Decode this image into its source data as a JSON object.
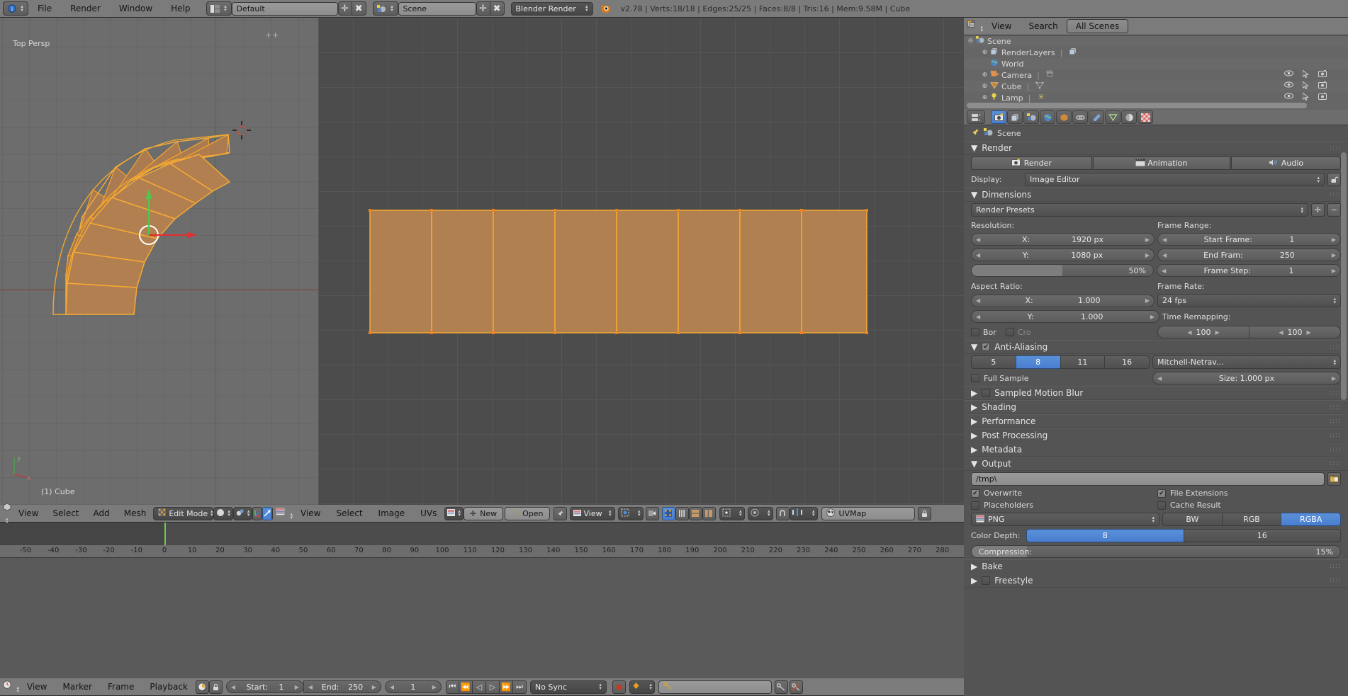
{
  "topbar": {
    "editor_icon": "editor-type-icon",
    "menus": [
      "File",
      "Render",
      "Window",
      "Help"
    ],
    "screen_layout_icon": "screen-layout-icon",
    "screen_layout": "Default",
    "scene_icon": "scene-icon",
    "scene": "Scene",
    "add_icon": "plus-icon",
    "remove_icon": "x-icon",
    "engine": "Blender Render",
    "blender_logo": "blender-logo-icon",
    "status": "v2.78 | Verts:18/18 | Edges:25/25 | Faces:8/8 | Tris:16 | Mem:9.58M | Cube"
  },
  "viewport": {
    "view_label": "Top Persp",
    "object_label": "(1) Cube",
    "axis_x": "x",
    "axis_y": "y",
    "header": {
      "editor_icon": "3d-view-icon",
      "menus": [
        "View",
        "Select",
        "Add",
        "Mesh"
      ],
      "mode_icon": "edit-mode-icon",
      "mode": "Edit Mode",
      "shading_icon": "solid-shading-icon",
      "pivot_icon": "pivot-point-icon",
      "manipulator_icons": [
        "translate-manipulator-icon",
        "rotate-manipulator-icon",
        "scale-manipulator-icon"
      ],
      "orientation_icon": "transform-orientation-icon"
    }
  },
  "uv_editor": {
    "header": {
      "editor_icon": "uv-image-editor-icon",
      "menus": [
        "View",
        "Select",
        "Image",
        "UVs"
      ],
      "image_icon": "image-datablock-icon",
      "new_label": "New",
      "new_icon": "plus-icon",
      "open_label": "Open",
      "open_icon": "folder-icon",
      "pin_icon": "pin-icon",
      "view_mode_icon": "image-icon",
      "view_mode": "View",
      "uv_select_mode_icon": "uv-vertex-select-icon",
      "sync_icon": "uv-sync-icon",
      "select_mode_icons": [
        "uv-vertex-icon",
        "uv-edge-icon",
        "uv-face-icon",
        "uv-island-icon"
      ],
      "sticky_icon": "sticky-selection-icon",
      "proportional_icon": "proportional-edit-icon",
      "snap_icon": "snap-magnet-icon",
      "snap_target_icon": "snap-target-icon",
      "uvmap_icon": "uvmap-icon",
      "uvmap": "UVMap",
      "lock_icon": "lock-icon"
    }
  },
  "timeline": {
    "ruler_ticks": [
      "-50",
      "-40",
      "-30",
      "-20",
      "-10",
      "0",
      "10",
      "20",
      "30",
      "40",
      "50",
      "60",
      "70",
      "80",
      "90",
      "100",
      "110",
      "120",
      "130",
      "140",
      "150",
      "160",
      "170",
      "180",
      "190",
      "200",
      "210",
      "220",
      "230",
      "240",
      "250",
      "260",
      "270",
      "280"
    ],
    "current_frame_marker": 0,
    "header": {
      "editor_icon": "timeline-icon",
      "menus": [
        "View",
        "Marker",
        "Frame",
        "Playback"
      ],
      "autokey_icon": "record-autokey-icon",
      "lock_icon": "lock-icon",
      "start_label": "Start:",
      "start_value": "1",
      "end_label": "End:",
      "end_value": "250",
      "current_frame": "1",
      "transport_icons": [
        "jump-to-start-icon",
        "prev-keyframe-icon",
        "play-reverse-icon",
        "play-icon",
        "next-keyframe-icon",
        "jump-to-end-icon"
      ],
      "sync_mode": "No Sync",
      "record_icon": "record-icon",
      "keyingset_icon": "keyframe-icon",
      "keyingset_field_icon": "keying-set-icon",
      "keyingset_value": "",
      "insert_keyframe_icon": "insert-keyframe-icon",
      "delete_keyframe_icon": "delete-keyframe-icon"
    }
  },
  "outliner": {
    "header": {
      "editor_icon": "outliner-icon",
      "menus": [
        "View",
        "Search"
      ],
      "display_mode": "All Scenes"
    },
    "rows": [
      {
        "label": "Scene",
        "icon": "scene-icon",
        "indent": 0,
        "expander": "collapse",
        "selected": true,
        "has_toggles": false,
        "datablock_icon": ""
      },
      {
        "label": "RenderLayers",
        "icon": "renderlayers-icon",
        "indent": 1,
        "expander": "expand",
        "selected": false,
        "has_toggles": false,
        "datablock_icon": "renderlayers-icon"
      },
      {
        "label": "World",
        "icon": "world-icon",
        "indent": 1,
        "expander": "none",
        "selected": false,
        "has_toggles": false,
        "datablock_icon": ""
      },
      {
        "label": "Camera",
        "icon": "camera-icon",
        "indent": 1,
        "expander": "expand",
        "selected": false,
        "has_toggles": true,
        "datablock_icon": "camera-data-icon"
      },
      {
        "label": "Cube",
        "icon": "mesh-object-icon",
        "indent": 1,
        "expander": "expand",
        "selected": false,
        "has_toggles": true,
        "datablock_icon": "mesh-data-icon"
      },
      {
        "label": "Lamp",
        "icon": "lamp-icon",
        "indent": 1,
        "expander": "expand",
        "selected": false,
        "has_toggles": true,
        "datablock_icon": "lamp-data-icon"
      }
    ],
    "toggle_icons": [
      "eye-icon",
      "cursor-arrow-icon",
      "camera-render-icon"
    ]
  },
  "properties": {
    "tabs": [
      {
        "icon": "render-tab-icon",
        "name": "render",
        "selected": true
      },
      {
        "icon": "render-layers-tab-icon",
        "name": "render-layers",
        "selected": false
      },
      {
        "icon": "scene-tab-icon",
        "name": "scene",
        "selected": false
      },
      {
        "icon": "world-tab-icon",
        "name": "world",
        "selected": false
      },
      {
        "icon": "object-tab-icon",
        "name": "object",
        "selected": false
      },
      {
        "icon": "constraints-tab-icon",
        "name": "constraints",
        "selected": false
      },
      {
        "icon": "modifiers-tab-icon",
        "name": "modifiers",
        "selected": false
      },
      {
        "icon": "data-tab-icon",
        "name": "object-data",
        "selected": false
      },
      {
        "icon": "material-tab-icon",
        "name": "material",
        "selected": false
      },
      {
        "icon": "texture-tab-icon",
        "name": "texture",
        "selected": false
      }
    ],
    "breadcrumb_icon": "pin-icon",
    "breadcrumb_scene_icon": "scene-icon",
    "breadcrumb": "Scene",
    "render_panel": {
      "title": "Render",
      "render_label": "Render",
      "render_icon": "camera-render-icon",
      "animation_label": "Animation",
      "animation_icon": "clapperboard-icon",
      "audio_label": "Audio",
      "audio_icon": "speaker-icon",
      "display_label": "Display:",
      "display_value": "Image Editor",
      "display_lock_icon": "unlock-icon"
    },
    "dimensions_panel": {
      "title": "Dimensions",
      "presets": "Render Presets",
      "preset_add_icon": "plus-icon",
      "preset_remove_icon": "minus-icon",
      "resolution_label": "Resolution:",
      "res_x_name": "X:",
      "res_x_value": "1920 px",
      "res_y_name": "Y:",
      "res_y_value": "1080 px",
      "res_percent": "50%",
      "res_percent_fill": 50,
      "aspect_label": "Aspect Ratio:",
      "aspect_x_name": "X:",
      "aspect_x_value": "1.000",
      "aspect_y_name": "Y:",
      "aspect_y_value": "1.000",
      "border_label": "Bor",
      "crop_label": "Cro",
      "frame_range_label": "Frame Range:",
      "start_frame": "Start Frame:",
      "start_frame_value": "1",
      "end_frame": "End Fram:",
      "end_frame_value": "250",
      "frame_step": "Frame Step:",
      "frame_step_value": "1",
      "frame_rate_label": "Frame Rate:",
      "frame_rate_value": "24 fps",
      "time_remap_label": "Time Remapping:",
      "time_remap_old": "100",
      "time_remap_new": "100"
    },
    "antialiasing_panel": {
      "title": "Anti-Aliasing",
      "enabled": true,
      "samples": [
        "5",
        "8",
        "11",
        "16"
      ],
      "samples_selected": "8",
      "filter": "Mitchell-Netrav...",
      "full_sample_label": "Full Sample",
      "full_sample_on": false,
      "size_label": "Size: 1.000 px"
    },
    "collapsed_panels": [
      {
        "title": "Sampled Motion Blur",
        "has_checkbox": true,
        "checked": false
      },
      {
        "title": "Shading",
        "has_checkbox": false,
        "checked": false
      },
      {
        "title": "Performance",
        "has_checkbox": false,
        "checked": false
      },
      {
        "title": "Post Processing",
        "has_checkbox": false,
        "checked": false
      },
      {
        "title": "Metadata",
        "has_checkbox": false,
        "checked": false
      }
    ],
    "output_panel": {
      "title": "Output",
      "path": "/tmp\\",
      "browse_icon": "folder-icon",
      "overwrite_label": "Overwrite",
      "overwrite_on": true,
      "file_extensions_label": "File Extensions",
      "file_extensions_on": true,
      "placeholders_label": "Placeholders",
      "placeholders_on": false,
      "cache_result_label": "Cache Result",
      "cache_result_on": false,
      "format_icon": "image-file-icon",
      "format": "PNG",
      "color_modes": [
        "BW",
        "RGB",
        "RGBA"
      ],
      "color_mode_selected": "RGBA",
      "color_depth_label": "Color Depth:",
      "color_depths": [
        "8",
        "16"
      ],
      "color_depth_selected": "8",
      "compression_label": "Compression:",
      "compression_value": "15%",
      "compression_fill": 15
    },
    "bake_panel": {
      "title": "Bake"
    },
    "freestyle_panel": {
      "title": "Freestyle",
      "checked": false
    }
  }
}
